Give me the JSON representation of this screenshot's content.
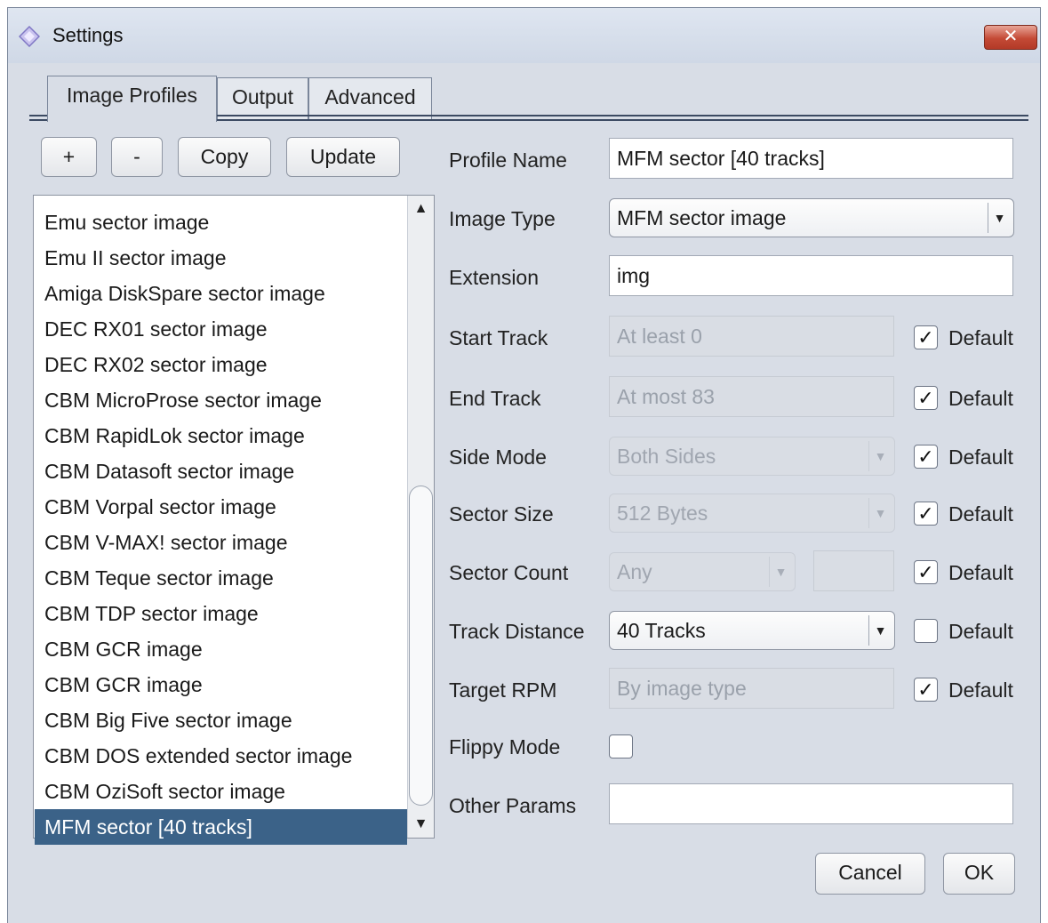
{
  "window": {
    "title": "Settings",
    "close_glyph": "✕"
  },
  "tabs": [
    {
      "label": "Image Profiles",
      "active": true
    },
    {
      "label": "Output",
      "active": false
    },
    {
      "label": "Advanced",
      "active": false
    }
  ],
  "toolbar": {
    "add_label": "+",
    "remove_label": "-",
    "copy_label": "Copy",
    "update_label": "Update"
  },
  "profiles": {
    "items": [
      "Emu sector image",
      "Emu II sector image",
      "Amiga DiskSpare sector image",
      "DEC RX01 sector image",
      "DEC RX02 sector image",
      "CBM MicroProse sector image",
      "CBM RapidLok sector image",
      "CBM Datasoft sector image",
      "CBM Vorpal sector image",
      "CBM V-MAX! sector image",
      "CBM Teque sector image",
      "CBM TDP sector image",
      "CBM GCR image",
      "CBM GCR image",
      "CBM Big Five sector image",
      "CBM DOS extended sector image",
      "CBM OziSoft sector image",
      "MFM sector [40 tracks]"
    ],
    "selected_index": 17,
    "scroll_up_glyph": "▲",
    "scroll_down_glyph": "▼"
  },
  "form": {
    "profile_name": {
      "label": "Profile Name",
      "value": "MFM sector [40 tracks]"
    },
    "image_type": {
      "label": "Image Type",
      "value": "MFM sector image"
    },
    "extension": {
      "label": "Extension",
      "value": "img"
    },
    "start_track": {
      "label": "Start Track",
      "placeholder": "At least 0",
      "default_label": "Default",
      "default_checked": true
    },
    "end_track": {
      "label": "End Track",
      "placeholder": "At most 83",
      "default_label": "Default",
      "default_checked": true
    },
    "side_mode": {
      "label": "Side Mode",
      "value": "Both Sides",
      "default_label": "Default",
      "default_checked": true
    },
    "sector_size": {
      "label": "Sector Size",
      "value": "512 Bytes",
      "default_label": "Default",
      "default_checked": true
    },
    "sector_count": {
      "label": "Sector Count",
      "value": "Any",
      "default_label": "Default",
      "default_checked": true
    },
    "track_distance": {
      "label": "Track Distance",
      "value": "40 Tracks",
      "default_label": "Default",
      "default_checked": false
    },
    "target_rpm": {
      "label": "Target RPM",
      "placeholder": "By image type",
      "default_label": "Default",
      "default_checked": true
    },
    "flippy_mode": {
      "label": "Flippy Mode",
      "checked": false
    },
    "other_params": {
      "label": "Other Params",
      "value": ""
    }
  },
  "footer": {
    "cancel_label": "Cancel",
    "ok_label": "OK"
  },
  "glyphs": {
    "check": "✓",
    "dropdown": "▼"
  },
  "colors": {
    "selection": "#3b6288",
    "window_bg": "#d8dde6",
    "close_red": "#c44a36"
  }
}
